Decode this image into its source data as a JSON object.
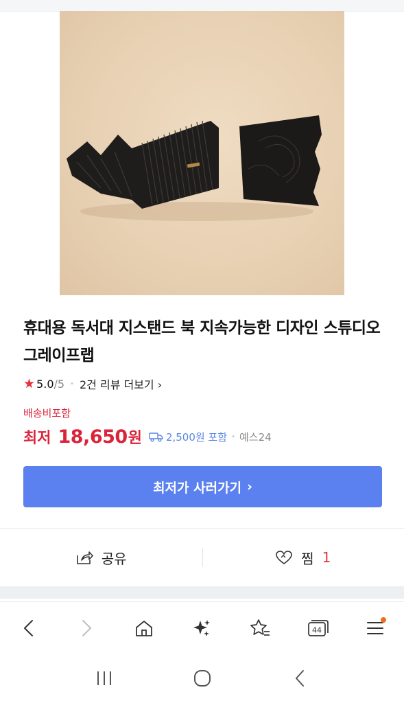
{
  "product": {
    "title": "휴대용 독서대 지스탠드 북 지속가능한 디자인 스튜디오 그레이프랩",
    "rating": {
      "score": "5.0",
      "max": "/5",
      "reviews_link": "2건 리뷰 더보기",
      "chevron": "›"
    },
    "shipping_label": "배송비포함",
    "price": {
      "prefix": "최저",
      "value": "18,650",
      "unit": "원",
      "shipping_fee": "2,500원 포함",
      "seller": "예스24"
    },
    "cta_label": "최저가 사러가기",
    "cta_chevron": "›"
  },
  "actions": {
    "share_label": "공유",
    "wishlist_label": "찜",
    "wishlist_count": "1"
  },
  "browser_bar": {
    "icons": [
      "back-icon",
      "forward-icon",
      "home-icon",
      "sparkle-icon",
      "bookmark-star-icon",
      "tabs-icon",
      "menu-icon"
    ],
    "tab_count": "44",
    "menu_has_notification": true
  },
  "system_nav": {
    "icons": [
      "recent-apps-icon",
      "home-circle-icon",
      "system-back-icon"
    ]
  },
  "colors": {
    "accent_red": "#d9243a",
    "cta_blue": "#5b80f0",
    "ship_blue": "#5b86e5",
    "notification_orange": "#f26a1b"
  }
}
